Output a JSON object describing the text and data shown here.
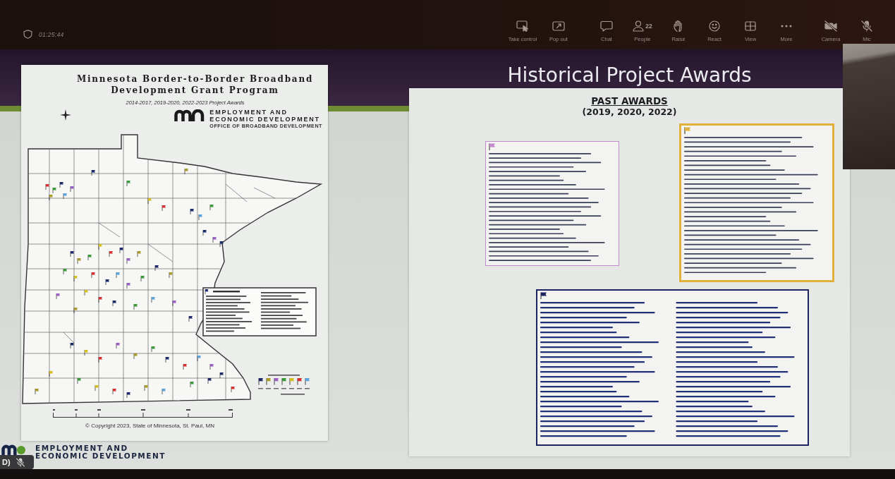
{
  "meeting_bar": {
    "timer": "01:25:44",
    "groups": [
      [
        {
          "kind": "take-control",
          "label": "Take control"
        },
        {
          "kind": "pop-out",
          "label": "Pop out"
        }
      ],
      [
        {
          "kind": "chat",
          "label": "Chat"
        },
        {
          "kind": "people",
          "label": "People",
          "count": "22"
        },
        {
          "kind": "raise",
          "label": "Raise"
        },
        {
          "kind": "react",
          "label": "React"
        },
        {
          "kind": "view",
          "label": "View"
        },
        {
          "kind": "more",
          "label": "More"
        }
      ],
      [
        {
          "kind": "camera",
          "label": "Camera",
          "on": false
        },
        {
          "kind": "mic",
          "label": "Mic",
          "on": false
        }
      ]
    ]
  },
  "slide": {
    "title": "Historical Project Awards",
    "poster": {
      "title_lines": [
        "Minnesota Border-to-Border Broadband",
        "Development Grant Program"
      ],
      "subtitle": "2014-2017, 2019-2020, 2022-2023 Project Awards",
      "agency_lines": [
        "EMPLOYMENT AND",
        "ECONOMIC DEVELOPMENT"
      ],
      "office": "OFFICE OF BROADBAND DEVELOPMENT",
      "copyright": "© Copyright 2023, State of Minnesota, St. Paul, MN"
    },
    "awards": {
      "heading": "PAST AWARDS",
      "years": "(2019, 2020, 2022)",
      "lists": [
        {
          "color": "#c48ad0"
        },
        {
          "color": "#e0b03a"
        },
        {
          "color": "#1c2562"
        }
      ]
    },
    "footer": {
      "agency_lines": [
        "EMPLOYMENT AND",
        "ECONOMIC DEVELOPMENT"
      ]
    }
  },
  "participant": {
    "name": "D)",
    "muted": true
  }
}
